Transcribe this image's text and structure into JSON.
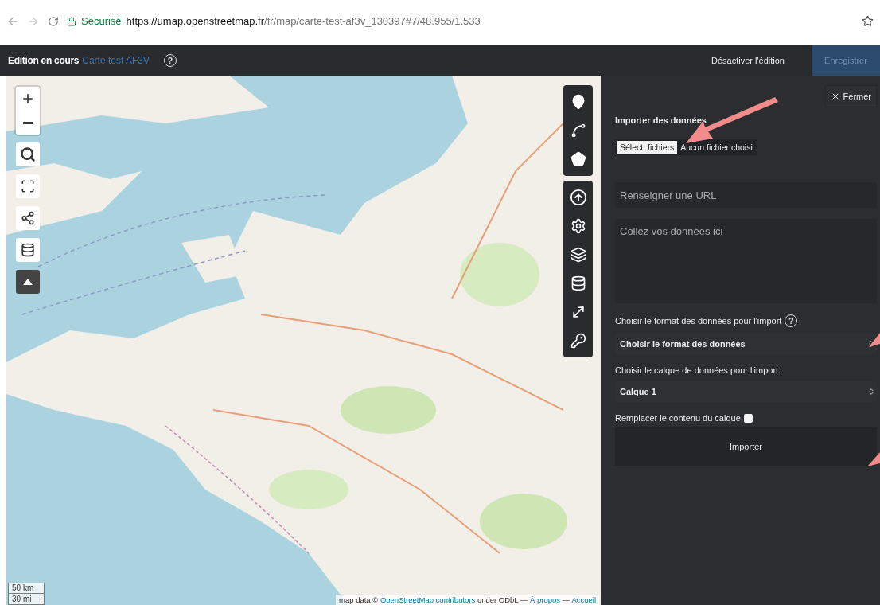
{
  "browser": {
    "secure_label": "Sécurisé",
    "url_host": "https://umap.openstreetmap.fr",
    "url_path": "/fr/map/carte-test-af3v_130397#7/48.955/1.533"
  },
  "header": {
    "status": "Edition en cours",
    "map_name": "Carte test AF3V",
    "help": "?",
    "disable_button": "Désactiver l'édition",
    "save_button": "Enregistrer"
  },
  "map": {
    "scale": [
      "50 km",
      "30 mi"
    ],
    "attribution": [
      {
        "kind": "text",
        "text": "map data © "
      },
      {
        "kind": "link",
        "text": "OpenStreetMap contributors"
      },
      {
        "kind": "text",
        "text": " under ODbL — "
      },
      {
        "kind": "link",
        "text": "À propos"
      },
      {
        "kind": "text",
        "text": " — "
      },
      {
        "kind": "link",
        "text": "Accueil"
      }
    ]
  },
  "panel": {
    "close_button": "Fermer",
    "title": "Importer des données",
    "file_button": "Sélect. fichiers",
    "file_status": "Aucun fichier choisi",
    "url_placeholder": "Renseigner une URL",
    "paste_placeholder": "Collez vos données ici",
    "format_label": "Choisir le format des données pour l'import",
    "format_help": "?",
    "format_select": "Choisir le format des données",
    "layer_label": "Choisir le calque de données pour l'import",
    "layer_select": "Calque 1",
    "replace_label": "Remplacer le contenu du calque",
    "replace_checked": false,
    "import_button": "Importer"
  }
}
